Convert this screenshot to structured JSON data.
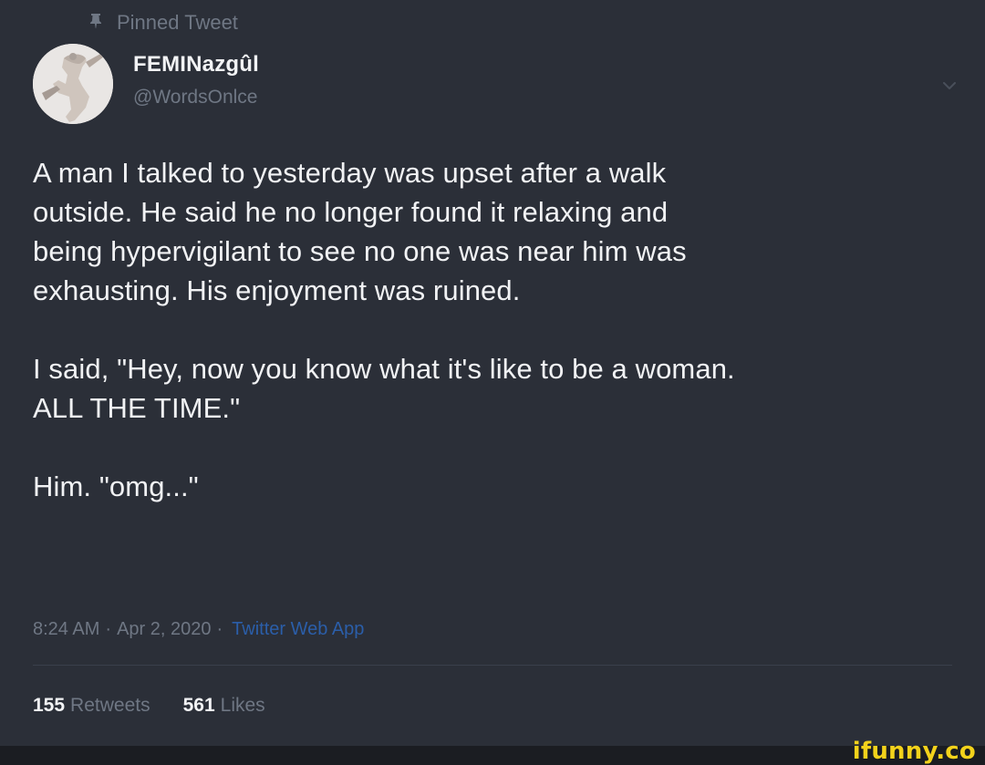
{
  "pinned": {
    "label": "Pinned Tweet",
    "icon": "pin-icon"
  },
  "user": {
    "display_name": "FEMINazgûl",
    "handle": "@WordsOnlce",
    "avatar_icon": "avatar"
  },
  "tweet": {
    "text": "A man I talked to yesterday was upset after a walk\noutside. He said he no longer found it relaxing and\nbeing hypervigilant to see no one was near him was\nexhausting. His enjoyment was ruined.\n\nI said, \"Hey, now you know what it's like to be a woman.\nALL THE TIME.\"\n\nHim. \"omg...\""
  },
  "meta": {
    "time": "8:24 AM",
    "separator": "·",
    "date": "Apr 2, 2020",
    "source": "Twitter Web App"
  },
  "stats": {
    "retweets_count": "155",
    "retweets_label": "Retweets",
    "likes_count": "561",
    "likes_label": "Likes"
  },
  "watermark": {
    "text": "ifunny.co"
  },
  "colors": {
    "background": "#2b2f38",
    "text": "#f1f2f4",
    "muted": "#6f7784",
    "link": "#2b5ea9",
    "watermark": "#f3d21b"
  }
}
